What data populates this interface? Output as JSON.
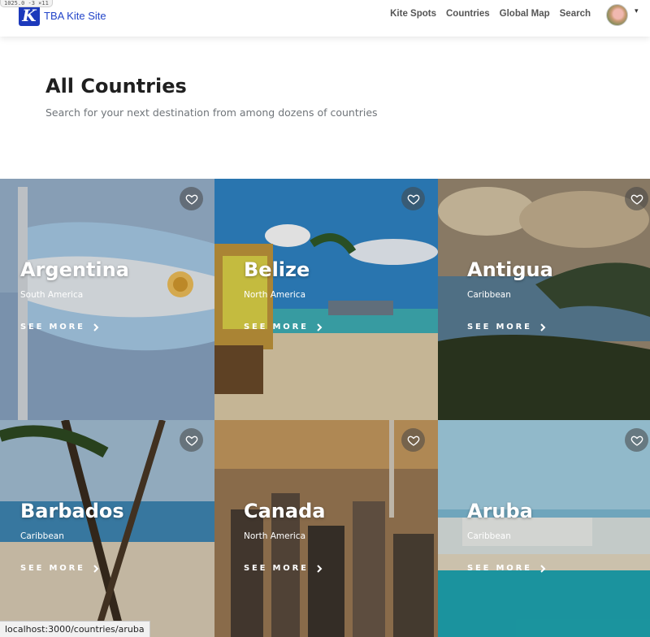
{
  "header": {
    "dev_badge": "1025.0 -3 ×11",
    "brand_letter": "K",
    "brand_name": "TBA Kite Site",
    "nav": [
      "Kite Spots",
      "Countries",
      "Global Map",
      "Search"
    ],
    "avatar_caret": "▾"
  },
  "hero": {
    "title": "All Countries",
    "subtitle": "Search for your next destination from among dozens of countries"
  },
  "cards": [
    {
      "name": "Argentina",
      "region": "South America",
      "cta": "SEE MORE",
      "favorite": false
    },
    {
      "name": "Belize",
      "region": "North America",
      "cta": "SEE MORE",
      "favorite": false
    },
    {
      "name": "Antigua",
      "region": "Caribbean",
      "cta": "SEE MORE",
      "favorite": false
    },
    {
      "name": "Barbados",
      "region": "Caribbean",
      "cta": "SEE MORE",
      "favorite": false
    },
    {
      "name": "Canada",
      "region": "North America",
      "cta": "SEE MORE",
      "favorite": false
    },
    {
      "name": "Aruba",
      "region": "Caribbean",
      "cta": "SEE MORE",
      "favorite": false
    }
  ],
  "status_bar": "localhost:3000/countries/aruba"
}
